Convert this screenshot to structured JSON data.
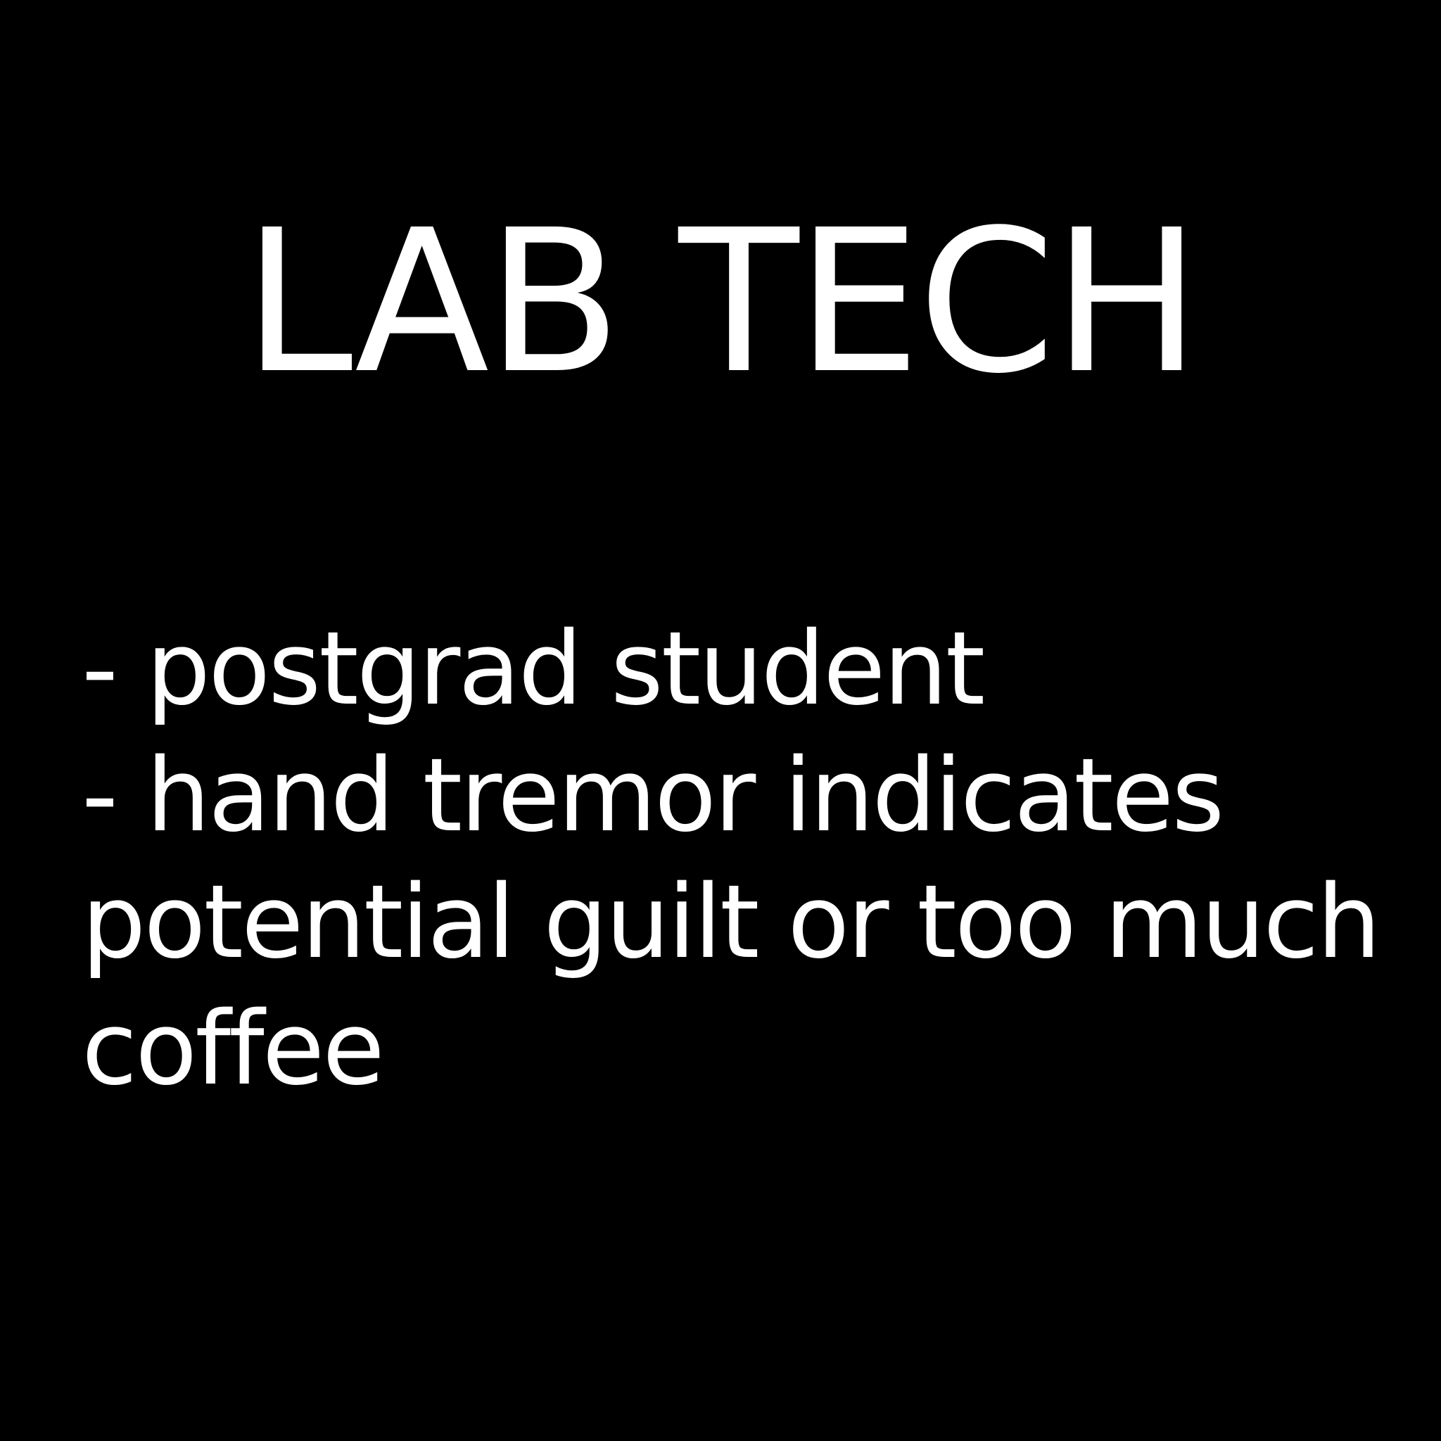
{
  "card": {
    "title": "LAB TECH",
    "notes": [
      "- postgrad student",
      "- hand tremor indicates potential guilt or too much coffee"
    ]
  },
  "colors": {
    "background": "#000000",
    "text": "#ffffff"
  }
}
